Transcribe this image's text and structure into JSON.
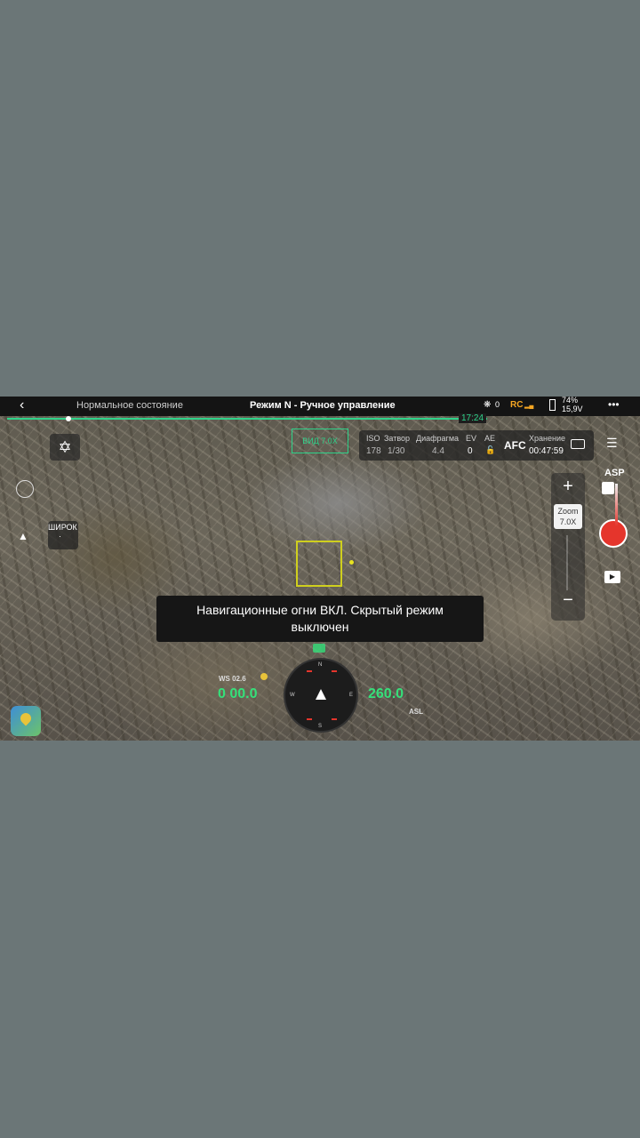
{
  "topbar": {
    "back_icon": "chevron-left-icon",
    "status": "Нормальное состояние",
    "mode": "Режим N - Ручное управление",
    "satellite_count": "0",
    "rc_label": "RC",
    "battery_percent": "74%",
    "battery_voltage": "15,9V",
    "more_label": "•••"
  },
  "flight_time": "17:24",
  "camera_settings": {
    "iso_label": "ISO",
    "iso_value": "178",
    "shutter_label": "Затвор",
    "shutter_value": "1/30",
    "aperture_label": "Диафрагма",
    "aperture_value": "4.4",
    "ev_label": "EV",
    "ev_value": "0",
    "ae_label": "AE",
    "focus_mode": "AFC",
    "storage_label": "Хранение",
    "storage_value": "00:47:59"
  },
  "camera_mode_chip": "ВИД 7.0X",
  "lens_mode": "ШИРОК",
  "zoom": {
    "plus": "+",
    "minus": "−",
    "label": "Zoom",
    "value": "7.0X"
  },
  "toast": {
    "line1": "Навигационные огни ВКЛ. Скрытый режим",
    "line2": "выключен"
  },
  "telemetry": {
    "ws_label": "WS 02.6",
    "left_value": "0 00.0",
    "right_value": "260.0",
    "asl_label": "ASL"
  },
  "watermark": "ASP",
  "colors": {
    "accent_green": "#2fd38a",
    "record_red": "#e5352c",
    "target_yellow": "#cfcf1e",
    "rc_orange": "#f5a623"
  }
}
